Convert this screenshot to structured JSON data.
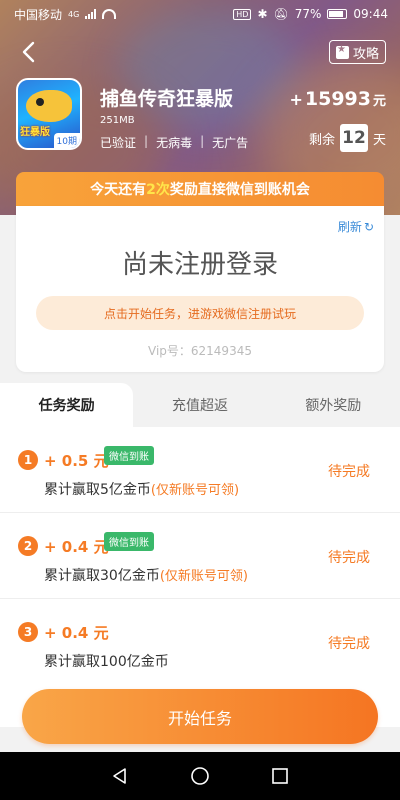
{
  "status": {
    "carrier": "中国移动",
    "net": "4G",
    "battery": "77%",
    "time": "09:44"
  },
  "header": {
    "guide_label": "攻略"
  },
  "app": {
    "title": "捕鱼传奇狂暴版",
    "size": "251MB",
    "icon_tag": "狂暴版",
    "issue": "10期",
    "tags": [
      "已验证",
      "无病毒",
      "无广告"
    ],
    "reward_plus": "+",
    "reward_amount": "15993",
    "reward_unit": "元",
    "remain_prefix": "剩余",
    "remain_days": "12",
    "remain_suffix": "天"
  },
  "promo": {
    "text_before": "今天还有",
    "count": "2次",
    "text_after": "奖励直接微信到账机会"
  },
  "login": {
    "refresh_label": "刷新",
    "status_text": "尚未注册登录",
    "hint": "点击开始任务，进游戏微信注册试玩",
    "vip": "Vip号：62149345"
  },
  "tabs": [
    {
      "label": "任务奖励",
      "active": true
    },
    {
      "label": "充值超返",
      "active": false
    },
    {
      "label": "额外奖励",
      "active": false
    }
  ],
  "tasks": [
    {
      "index": "1",
      "amount": "+ 0.5 元",
      "badge": "微信到账",
      "desc": "累计赢取5亿金币",
      "note": "(仅新账号可领)",
      "status": "待完成"
    },
    {
      "index": "2",
      "amount": "+ 0.4 元",
      "badge": "微信到账",
      "desc": "累计赢取30亿金币",
      "note": "(仅新账号可领)",
      "status": "待完成"
    },
    {
      "index": "3",
      "amount": "+ 0.4 元",
      "badge": "",
      "desc": "累计赢取100亿金币",
      "note": "",
      "status": "待完成"
    }
  ],
  "start_button": "开始任务",
  "colors": {
    "accent": "#f57b25",
    "wechat": "#3ab86a",
    "link": "#3a8bd8"
  }
}
